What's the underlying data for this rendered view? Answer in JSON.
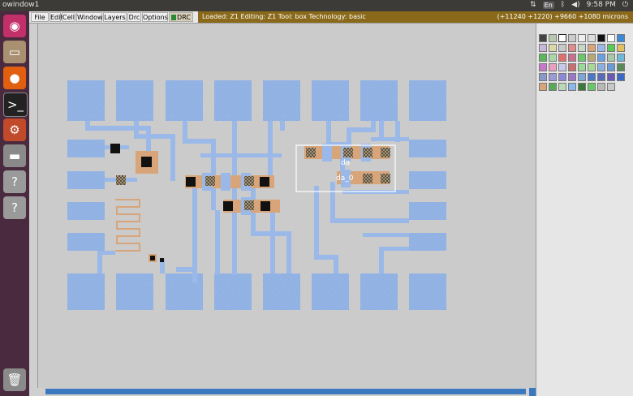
{
  "topbar": {
    "title": "owindow1",
    "keyboard": "En",
    "time": "9:58 PM"
  },
  "menu": {
    "file": "File",
    "edit": "Edit",
    "cell": "Cell",
    "window": "Window",
    "layers": "Layers",
    "drc": "Drc",
    "options": "Options",
    "drc_button": "DRC"
  },
  "status": {
    "left": "Loaded: Z1  Editing: Z1  Tool: box  Technology: basic",
    "right": "(+11240 +1220) +9660 +1080 microns"
  },
  "labels": {
    "da": "da",
    "da_0": "da_0"
  },
  "colors": {
    "metal": "#9ab9e8",
    "contact": "#d8a57a",
    "via": "#111111",
    "selection": "#ffffff"
  },
  "launcher_icons": [
    "ubuntu-icon",
    "files-icon",
    "firefox-icon",
    "terminal-icon",
    "settings-icon",
    "drive-icon",
    "help-icon",
    "help-icon",
    "trash-icon"
  ]
}
